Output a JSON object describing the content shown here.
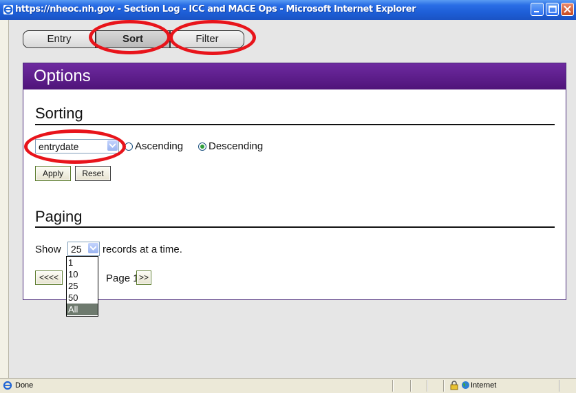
{
  "window": {
    "title": "https://nheoc.nh.gov - Section Log - ICC and MACE Ops - Microsoft Internet Explorer"
  },
  "tabs": [
    {
      "label": "Entry"
    },
    {
      "label": "Sort"
    },
    {
      "label": "Filter"
    }
  ],
  "panel": {
    "header": "Options",
    "sorting": {
      "title": "Sorting",
      "field_value": "entrydate",
      "ascending_label": "Ascending",
      "descending_label": "Descending",
      "selected_order": "Descending",
      "apply_label": "Apply",
      "reset_label": "Reset"
    },
    "paging": {
      "title": "Paging",
      "show_label": "Show",
      "records_value": "25",
      "records_suffix": "records at a time.",
      "prev_label": "<<<<",
      "page_label": "Page 1",
      "next_label": ">>",
      "options": [
        "1",
        "10",
        "25",
        "50",
        "All"
      ],
      "highlighted_option": "All"
    }
  },
  "statusbar": {
    "status": "Done",
    "zone": "Internet"
  },
  "colors": {
    "header_purple": "#5b1a87",
    "annotation_red": "#e8141b",
    "titlebar_blue": "#2a6ee6"
  },
  "icons": [
    "ie-icon",
    "minimize-icon",
    "maximize-icon",
    "close-icon",
    "chevron-down-icon",
    "lock-icon",
    "globe-icon"
  ]
}
